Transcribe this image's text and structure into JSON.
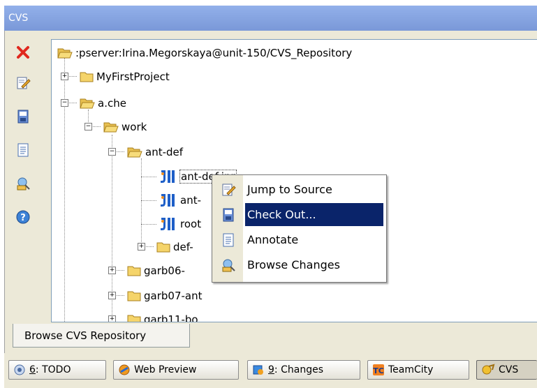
{
  "window": {
    "title": "CVS"
  },
  "toolbar": {
    "items": [
      {
        "name": "close-icon"
      },
      {
        "name": "jump-to-source-icon"
      },
      {
        "name": "check-out-icon"
      },
      {
        "name": "annotate-icon"
      },
      {
        "name": "browse-changes-icon"
      },
      {
        "name": "help-icon"
      }
    ]
  },
  "tree": {
    "root": ":pserver:Irina.Megorskaya@unit-150/CVS_Repository",
    "my_first_project": "MyFirstProject",
    "a_che": "a.che",
    "work": "work",
    "ant_def": "ant-def",
    "file1": "ant-def.ipr",
    "file2": "ant-",
    "file3": "root",
    "def_folder": "def-",
    "garb06": "garb06-",
    "garb07": "garb07-ant",
    "garb11": "garb11-bo"
  },
  "context_menu": {
    "items": [
      {
        "label": "Jump to Source",
        "mnemonic": "J"
      },
      {
        "label": "Check Out...",
        "selected": true
      },
      {
        "label": "Annotate"
      },
      {
        "label": "Browse Changes"
      }
    ]
  },
  "tabs": {
    "browse": "Browse CVS Repository"
  },
  "statusbar": {
    "todo_num": "6",
    "todo": ": TODO",
    "web_preview": "Web Preview",
    "changes_num": "9",
    "changes": ": Changes",
    "teamcity": "TeamCity",
    "cvs": "CVS"
  },
  "colors": {
    "title_bar": "#7a98d8",
    "selection": "#0a246a",
    "folder": "#f5d46a"
  }
}
